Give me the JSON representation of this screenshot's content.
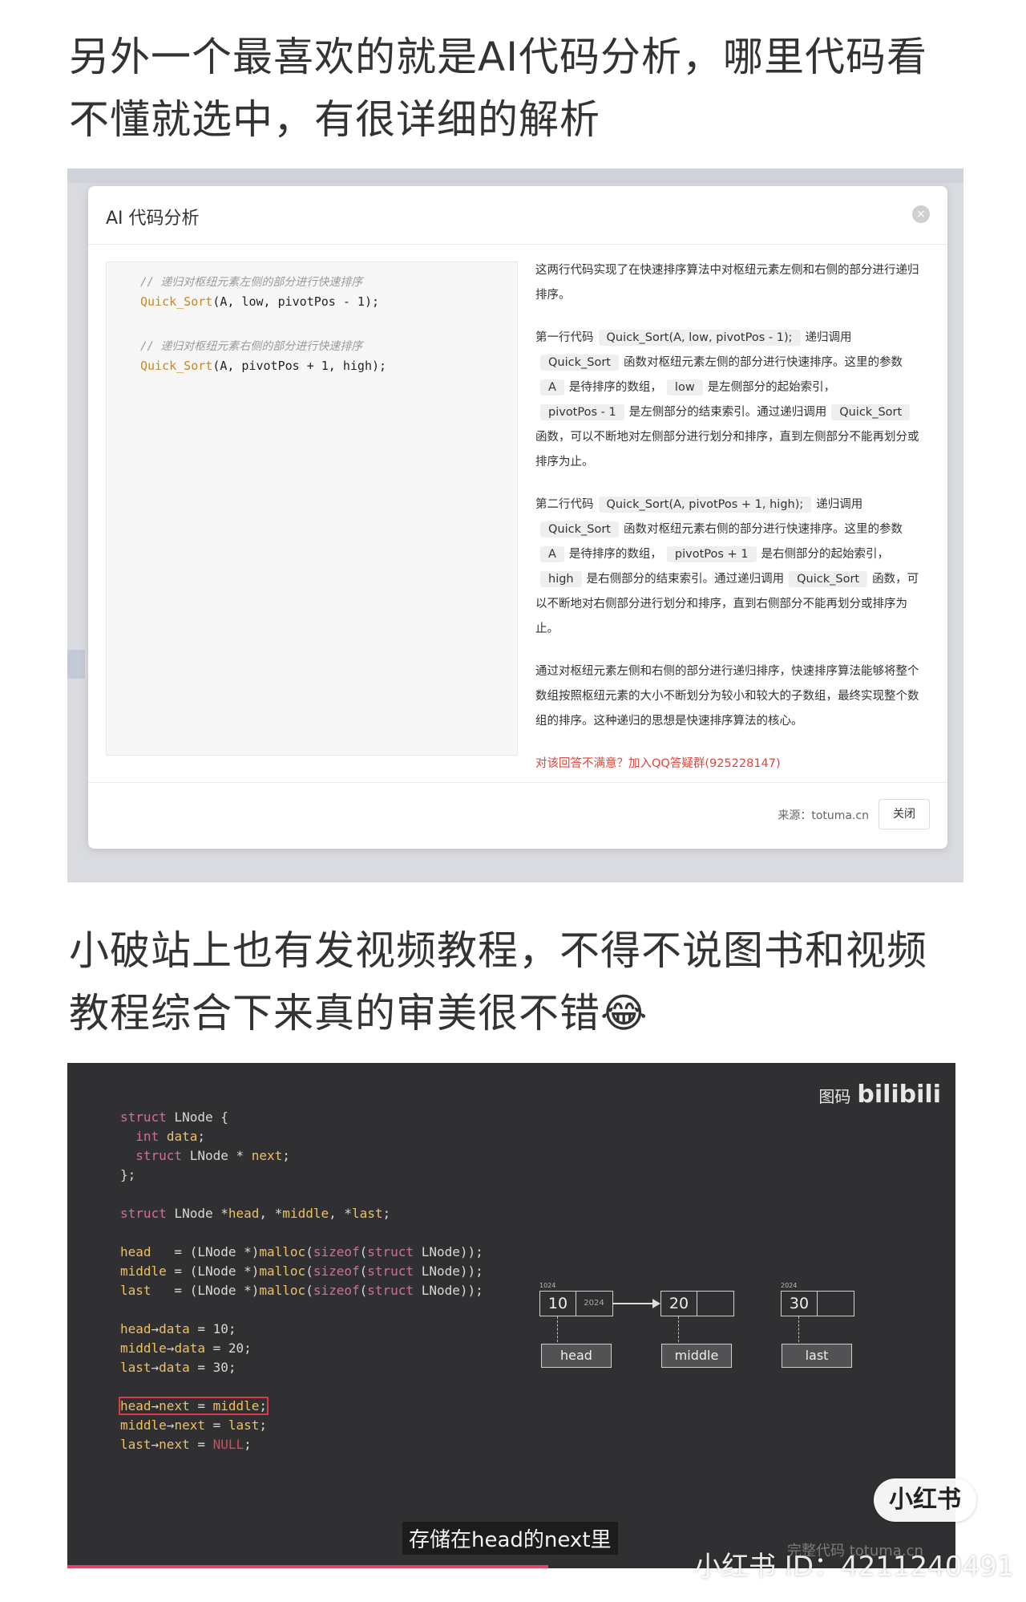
{
  "captions": {
    "top": "另外一个最喜欢的就是AI代码分析，哪里代码看不懂就选中，有很详细的解析",
    "middle": "小破站上也有发视频教程，不得不说图书和视频教程综合下来真的审美很不错😂"
  },
  "modal": {
    "title": "AI 代码分析",
    "close_icon": "×",
    "code": {
      "comment1": "// 递归对枢纽元素左侧的部分进行快速排序",
      "call1_fn": "Quick_Sort",
      "call1_args": "(A, low, pivotPos - 1);",
      "comment2": "// 递归对枢纽元素右侧的部分进行快速排序",
      "call2_fn": "Quick_Sort",
      "call2_args": "(A, pivotPos + 1, high);"
    },
    "explanation": {
      "intro": "这两行代码实现了在快速排序算法中对枢纽元素左侧和右侧的部分进行递归排序。",
      "l1_prefix": "第一行代码",
      "l1_chip": "Quick_Sort(A, low, pivotPos - 1);",
      "l1_a": "递归调用",
      "l1_chip2": "Quick_Sort",
      "l1_b": "函数对枢纽元素左侧的部分进行快速排序。这里的参数",
      "l1_chip3": "A",
      "l1_c": "是待排序的数组，",
      "l1_chip4": "low",
      "l1_d": "是左侧部分的起始索引，",
      "l1_chip5": "pivotPos - 1",
      "l1_e": "是左侧部分的结束索引。通过递归调用",
      "l1_chip6": "Quick_Sort",
      "l1_f": "函数，可以不断地对左侧部分进行划分和排序，直到左侧部分不能再划分或排序为止。",
      "l2_prefix": "第二行代码",
      "l2_chip": "Quick_Sort(A, pivotPos + 1, high);",
      "l2_a": "递归调用",
      "l2_chip2": "Quick_Sort",
      "l2_b": "函数对枢纽元素右侧的部分进行快速排序。这里的参数",
      "l2_chip3": "A",
      "l2_c": "是待排序的数组，",
      "l2_chip4": "pivotPos + 1",
      "l2_d": "是右侧部分的起始索引，",
      "l2_chip5": "high",
      "l2_e": "是右侧部分的结束索引。通过递归调用",
      "l2_chip6": "Quick_Sort",
      "l2_f": "函数，可以不断地对右侧部分进行划分和排序，直到右侧部分不能再划分或排序为止。",
      "summary": "通过对枢纽元素左侧和右侧的部分进行递归排序，快速排序算法能够将整个数组按照枢纽元素的大小不断划分为较小和较大的子数组，最终实现整个数组的排序。这种递归的思想是快速排序算法的核心。",
      "feedback": "对该回答不满意？加入QQ答疑群(925228147)"
    },
    "footer": {
      "source": "来源：totuma.cn",
      "close_button": "关闭"
    }
  },
  "video": {
    "logo_cn": "图码",
    "logo_bili": "bilibili",
    "code_lines": [
      "struct LNode {",
      "  int data;",
      "  struct LNode * next;",
      "};",
      "",
      "struct LNode *head, *middle, *last;",
      "",
      "head   = (LNode *)malloc(sizeof(struct LNode));",
      "middle = (LNode *)malloc(sizeof(struct LNode));",
      "last   = (LNode *)malloc(sizeof(struct LNode));",
      "",
      "head→data = 10;",
      "middle→data = 20;",
      "last→data = 30;",
      "",
      "head→next = middle;",
      "middle→next = last;",
      "last→next = NULL;"
    ],
    "nodes": [
      {
        "addr": "1024",
        "value": "10",
        "next": "2024",
        "label": "head"
      },
      {
        "addr": "",
        "value": "20",
        "next": "",
        "label": "middle"
      },
      {
        "addr": "2024",
        "value": "30",
        "next": "",
        "label": "last"
      }
    ],
    "subtitle": "存储在head的next里",
    "watermark": "完整代码 totuma.cn"
  },
  "overlay": {
    "badge": "小红书",
    "user_id": "小红书 ID：4211240491"
  }
}
